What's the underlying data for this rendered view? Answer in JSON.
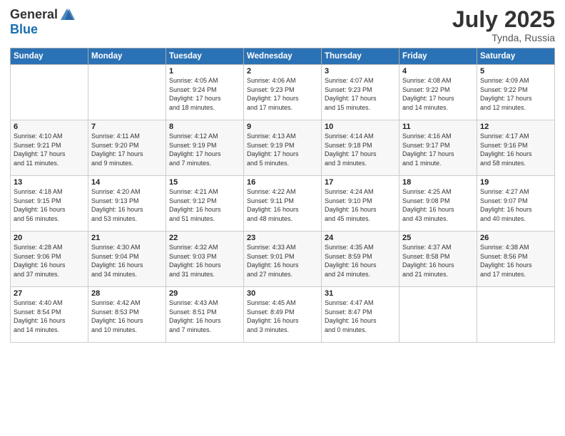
{
  "header": {
    "logo_general": "General",
    "logo_blue": "Blue",
    "month": "July 2025",
    "location": "Tynda, Russia"
  },
  "weekdays": [
    "Sunday",
    "Monday",
    "Tuesday",
    "Wednesday",
    "Thursday",
    "Friday",
    "Saturday"
  ],
  "weeks": [
    [
      {
        "day": "",
        "info": ""
      },
      {
        "day": "",
        "info": ""
      },
      {
        "day": "1",
        "info": "Sunrise: 4:05 AM\nSunset: 9:24 PM\nDaylight: 17 hours\nand 18 minutes."
      },
      {
        "day": "2",
        "info": "Sunrise: 4:06 AM\nSunset: 9:23 PM\nDaylight: 17 hours\nand 17 minutes."
      },
      {
        "day": "3",
        "info": "Sunrise: 4:07 AM\nSunset: 9:23 PM\nDaylight: 17 hours\nand 15 minutes."
      },
      {
        "day": "4",
        "info": "Sunrise: 4:08 AM\nSunset: 9:22 PM\nDaylight: 17 hours\nand 14 minutes."
      },
      {
        "day": "5",
        "info": "Sunrise: 4:09 AM\nSunset: 9:22 PM\nDaylight: 17 hours\nand 12 minutes."
      }
    ],
    [
      {
        "day": "6",
        "info": "Sunrise: 4:10 AM\nSunset: 9:21 PM\nDaylight: 17 hours\nand 11 minutes."
      },
      {
        "day": "7",
        "info": "Sunrise: 4:11 AM\nSunset: 9:20 PM\nDaylight: 17 hours\nand 9 minutes."
      },
      {
        "day": "8",
        "info": "Sunrise: 4:12 AM\nSunset: 9:19 PM\nDaylight: 17 hours\nand 7 minutes."
      },
      {
        "day": "9",
        "info": "Sunrise: 4:13 AM\nSunset: 9:19 PM\nDaylight: 17 hours\nand 5 minutes."
      },
      {
        "day": "10",
        "info": "Sunrise: 4:14 AM\nSunset: 9:18 PM\nDaylight: 17 hours\nand 3 minutes."
      },
      {
        "day": "11",
        "info": "Sunrise: 4:16 AM\nSunset: 9:17 PM\nDaylight: 17 hours\nand 1 minute."
      },
      {
        "day": "12",
        "info": "Sunrise: 4:17 AM\nSunset: 9:16 PM\nDaylight: 16 hours\nand 58 minutes."
      }
    ],
    [
      {
        "day": "13",
        "info": "Sunrise: 4:18 AM\nSunset: 9:15 PM\nDaylight: 16 hours\nand 56 minutes."
      },
      {
        "day": "14",
        "info": "Sunrise: 4:20 AM\nSunset: 9:13 PM\nDaylight: 16 hours\nand 53 minutes."
      },
      {
        "day": "15",
        "info": "Sunrise: 4:21 AM\nSunset: 9:12 PM\nDaylight: 16 hours\nand 51 minutes."
      },
      {
        "day": "16",
        "info": "Sunrise: 4:22 AM\nSunset: 9:11 PM\nDaylight: 16 hours\nand 48 minutes."
      },
      {
        "day": "17",
        "info": "Sunrise: 4:24 AM\nSunset: 9:10 PM\nDaylight: 16 hours\nand 45 minutes."
      },
      {
        "day": "18",
        "info": "Sunrise: 4:25 AM\nSunset: 9:08 PM\nDaylight: 16 hours\nand 43 minutes."
      },
      {
        "day": "19",
        "info": "Sunrise: 4:27 AM\nSunset: 9:07 PM\nDaylight: 16 hours\nand 40 minutes."
      }
    ],
    [
      {
        "day": "20",
        "info": "Sunrise: 4:28 AM\nSunset: 9:06 PM\nDaylight: 16 hours\nand 37 minutes."
      },
      {
        "day": "21",
        "info": "Sunrise: 4:30 AM\nSunset: 9:04 PM\nDaylight: 16 hours\nand 34 minutes."
      },
      {
        "day": "22",
        "info": "Sunrise: 4:32 AM\nSunset: 9:03 PM\nDaylight: 16 hours\nand 31 minutes."
      },
      {
        "day": "23",
        "info": "Sunrise: 4:33 AM\nSunset: 9:01 PM\nDaylight: 16 hours\nand 27 minutes."
      },
      {
        "day": "24",
        "info": "Sunrise: 4:35 AM\nSunset: 8:59 PM\nDaylight: 16 hours\nand 24 minutes."
      },
      {
        "day": "25",
        "info": "Sunrise: 4:37 AM\nSunset: 8:58 PM\nDaylight: 16 hours\nand 21 minutes."
      },
      {
        "day": "26",
        "info": "Sunrise: 4:38 AM\nSunset: 8:56 PM\nDaylight: 16 hours\nand 17 minutes."
      }
    ],
    [
      {
        "day": "27",
        "info": "Sunrise: 4:40 AM\nSunset: 8:54 PM\nDaylight: 16 hours\nand 14 minutes."
      },
      {
        "day": "28",
        "info": "Sunrise: 4:42 AM\nSunset: 8:53 PM\nDaylight: 16 hours\nand 10 minutes."
      },
      {
        "day": "29",
        "info": "Sunrise: 4:43 AM\nSunset: 8:51 PM\nDaylight: 16 hours\nand 7 minutes."
      },
      {
        "day": "30",
        "info": "Sunrise: 4:45 AM\nSunset: 8:49 PM\nDaylight: 16 hours\nand 3 minutes."
      },
      {
        "day": "31",
        "info": "Sunrise: 4:47 AM\nSunset: 8:47 PM\nDaylight: 16 hours\nand 0 minutes."
      },
      {
        "day": "",
        "info": ""
      },
      {
        "day": "",
        "info": ""
      }
    ]
  ]
}
